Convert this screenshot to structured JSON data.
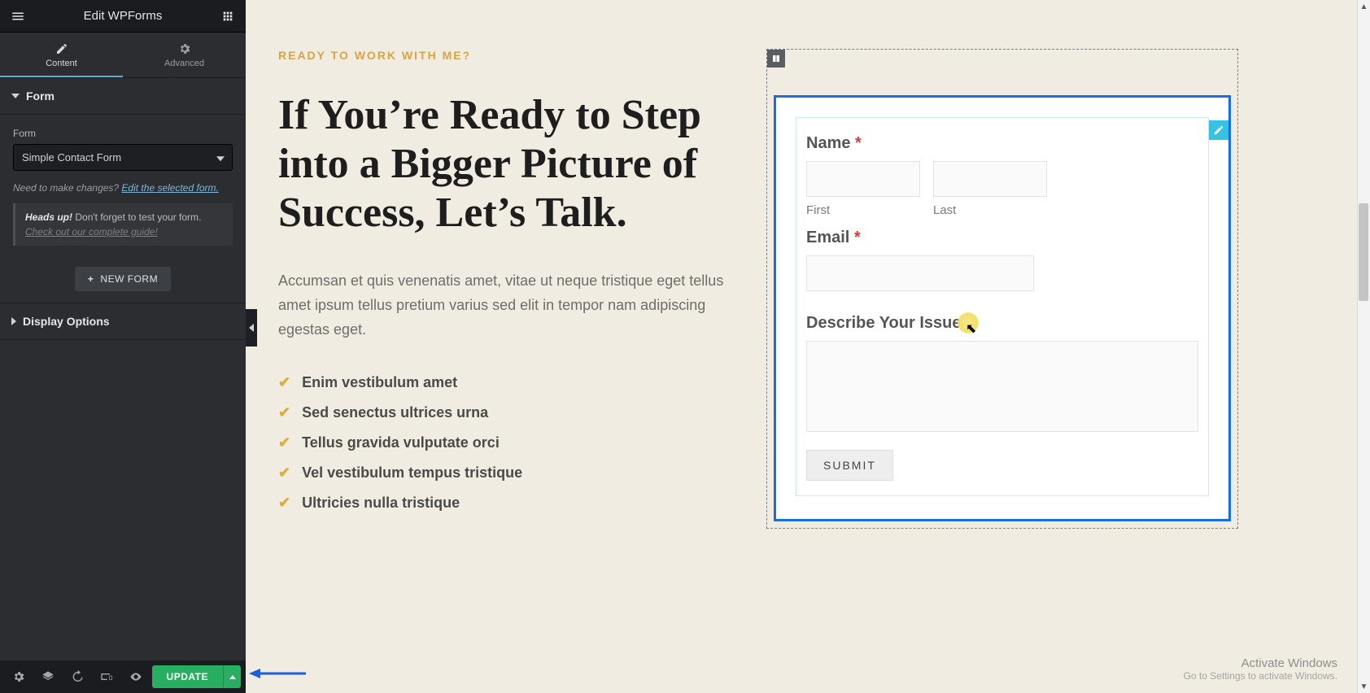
{
  "panel": {
    "title": "Edit WPForms",
    "tabs": {
      "content": "Content",
      "advanced": "Advanced"
    },
    "sections": {
      "form": "Form",
      "display": "Display Options"
    },
    "form_field_label": "Form",
    "form_selected": "Simple Contact Form",
    "hint_prefix": "Need to make changes? ",
    "hint_link": "Edit the selected form.",
    "note_bold": "Heads up!",
    "note_text": " Don't forget to test your form.",
    "note_sub": "Check out our complete guide!",
    "new_form": "NEW FORM",
    "update": "UPDATE"
  },
  "page": {
    "eyebrow": "READY TO WORK WITH ME?",
    "headline": "If You’re Ready to Step into a Bigger Picture of Success, Let’s Talk.",
    "paragraph": "Accumsan et quis venenatis amet, vitae ut neque tristique eget tellus amet ipsum tellus pretium varius sed elit in tempor nam adipiscing egestas eget.",
    "features": [
      "Enim vestibulum amet",
      "Sed senectus ultrices urna",
      "Tellus gravida vulputate orci",
      "Vel vestibulum tempus tristique",
      "Ultricies nulla tristique"
    ]
  },
  "form": {
    "name_label": "Name ",
    "first": "First",
    "last": "Last",
    "email_label": "Email ",
    "issue_label": "Describe Your Issue ",
    "required": "*",
    "submit": "SUBMIT"
  },
  "watermark": {
    "title": "Activate Windows",
    "sub": "Go to Settings to activate Windows."
  }
}
